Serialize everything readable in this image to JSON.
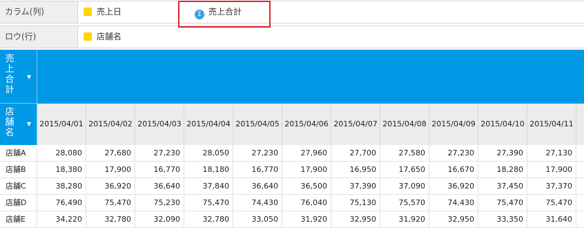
{
  "shelves": {
    "columns": {
      "label": "カラム(列)",
      "pills": [
        {
          "label": "売上日",
          "icon": "yellow-square-icon"
        },
        {
          "label": "売上合計",
          "icon": "sigma-icon"
        }
      ]
    },
    "rows": {
      "label": "ロウ(行)",
      "pills": [
        {
          "label": "店舗名",
          "icon": "yellow-square-icon"
        }
      ]
    }
  },
  "grid": {
    "measure_header": "売上合計",
    "row_header": "店舗名",
    "caret": "▼",
    "dates": [
      "2015/04/01",
      "2015/04/02",
      "2015/04/03",
      "2015/04/04",
      "2015/04/05",
      "2015/04/06",
      "2015/04/07",
      "2015/04/08",
      "2015/04/09",
      "2015/04/10",
      "2015/04/11"
    ],
    "rows": [
      {
        "store": "店舗A",
        "values": [
          "28,080",
          "27,680",
          "27,230",
          "28,050",
          "27,230",
          "27,960",
          "27,700",
          "27,580",
          "27,230",
          "27,390",
          "27,130"
        ]
      },
      {
        "store": "店舗B",
        "values": [
          "18,380",
          "17,900",
          "16,770",
          "18,180",
          "16,770",
          "17,900",
          "16,950",
          "17,650",
          "16,670",
          "18,280",
          "17,900"
        ]
      },
      {
        "store": "店舗C",
        "values": [
          "38,280",
          "36,920",
          "36,640",
          "37,840",
          "36,640",
          "36,500",
          "37,390",
          "37,090",
          "36,920",
          "37,450",
          "37,370"
        ]
      },
      {
        "store": "店舗D",
        "values": [
          "76,490",
          "75,470",
          "75,230",
          "75,470",
          "74,430",
          "76,040",
          "75,130",
          "75,570",
          "74,430",
          "75,470",
          "75,470"
        ]
      },
      {
        "store": "店舗E",
        "values": [
          "34,220",
          "32,780",
          "32,090",
          "32,780",
          "33,050",
          "31,920",
          "32,950",
          "31,920",
          "32,950",
          "33,350",
          "31,640"
        ]
      }
    ]
  },
  "colors": {
    "header_blue": "#0099e5",
    "highlight_red": "#d8262f",
    "dimension_yellow": "#ffd400",
    "measure_blue": "#3aa0e0"
  }
}
